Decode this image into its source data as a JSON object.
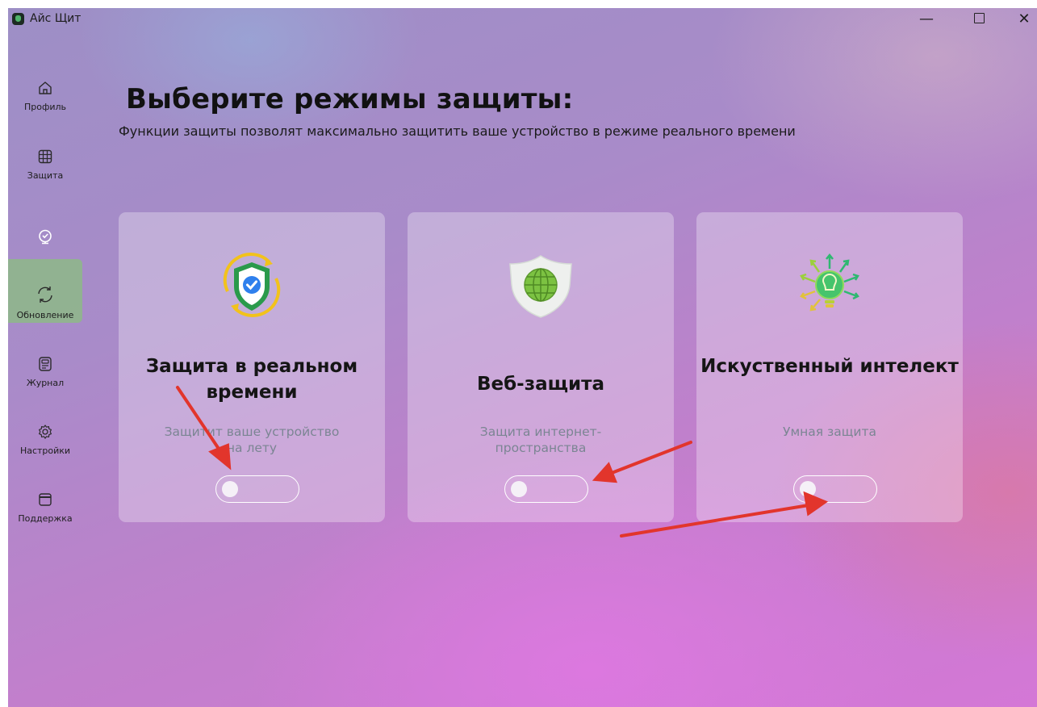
{
  "window": {
    "title": "Айс Щит",
    "controls": {
      "minimize": "—",
      "close": "✕"
    }
  },
  "sidebar": {
    "items": [
      {
        "label": "Профиль",
        "icon": "home-icon",
        "active": false
      },
      {
        "label": "Защита",
        "icon": "grid-icon",
        "active": false
      },
      {
        "label": "",
        "icon": "monitor-shield-icon",
        "active": true
      },
      {
        "label": "Обновление",
        "icon": "refresh-icon",
        "active": false
      },
      {
        "label": "Журнал",
        "icon": "journal-icon",
        "active": false
      },
      {
        "label": "Настройки",
        "icon": "gear-icon",
        "active": false
      },
      {
        "label": "Поддержка",
        "icon": "window-icon",
        "active": false
      }
    ]
  },
  "main": {
    "title": "Выберите режимы защиты:",
    "subtitle": "Функции защиты позволят максимально защитить ваше устройство в режиме реального времени",
    "cards": [
      {
        "title": "Защита в реальном времени",
        "description": "Защитит ваше устройство на лету",
        "icon": "shield-check-icon",
        "enabled": false
      },
      {
        "title": "Веб-защита",
        "description": "Защита интернет-пространства",
        "icon": "globe-shield-icon",
        "enabled": false
      },
      {
        "title": "Искуственный интелект",
        "description": "Умная защита",
        "icon": "lightbulb-icon",
        "enabled": false
      }
    ]
  },
  "colors": {
    "active_nav": "#8fb68b",
    "card_background": "rgba(255,255,255,0.30)",
    "annotation_arrow": "#e2352c"
  }
}
